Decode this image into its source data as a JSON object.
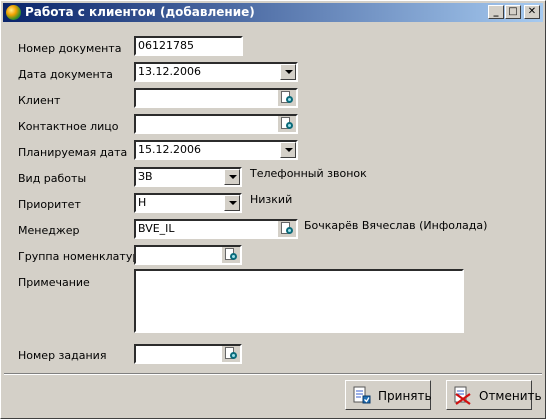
{
  "window": {
    "title": "Работа с клиентом (добавление)",
    "minimize_glyph": "_",
    "maximize_glyph": "□",
    "close_glyph": "✕"
  },
  "form": {
    "doc_number": {
      "label": "Номер документа",
      "value": "06121785"
    },
    "doc_date": {
      "label": "Дата документа",
      "value": "13.12.2006"
    },
    "client": {
      "label": "Клиент",
      "value": ""
    },
    "contact": {
      "label": "Контактное лицо",
      "value": ""
    },
    "planned_date": {
      "label": "Планируемая дата",
      "value": "15.12.2006"
    },
    "work_type": {
      "label": "Вид работы",
      "value": "ЗВ",
      "description": "Телефонный звонок"
    },
    "priority": {
      "label": "Приоритет",
      "value": "Н",
      "description": "Низкий"
    },
    "manager": {
      "label": "Менеджер",
      "value": "BVE_IL",
      "description": "Бочкарёв Вячеслав (Инфолада)"
    },
    "nomenclature_group": {
      "label": "Группа номенклатуры",
      "value": ""
    },
    "note": {
      "label": "Примечание",
      "value": ""
    },
    "task_number": {
      "label": "Номер задания",
      "value": ""
    }
  },
  "buttons": {
    "accept": "Принять",
    "cancel": "Отменить"
  },
  "icons": {
    "app": "app-icon",
    "lookup": "lookup-icon",
    "accept": "document-check-icon",
    "cancel": "document-cancel-icon"
  }
}
